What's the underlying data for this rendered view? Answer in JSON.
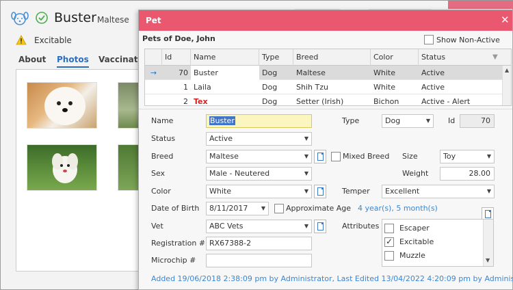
{
  "background": {
    "pet_name": "Buster",
    "pet_breed": "Maltese",
    "alert": "Excitable",
    "tabs": [
      {
        "label": "About",
        "active": false
      },
      {
        "label": "Photos",
        "active": true
      },
      {
        "label": "Vaccination",
        "active": false
      }
    ]
  },
  "dialog": {
    "title": "Pet",
    "close_glyph": "✕",
    "owner": "Pets of Doe, John",
    "show_non_active": {
      "label": "Show Non-Active",
      "checked": false
    },
    "grid": {
      "headers": [
        "Id",
        "Name",
        "Type",
        "Breed",
        "Color",
        "Status"
      ],
      "indicator": "→",
      "rows": [
        {
          "id": "70",
          "name": "Buster",
          "type": "Dog",
          "breed": "Maltese",
          "color": "White",
          "status": "Active",
          "selected": true
        },
        {
          "id": "1",
          "name": "Laila",
          "type": "Dog",
          "breed": "Shih Tzu",
          "color": "White",
          "status": "Active",
          "selected": false
        },
        {
          "id": "2",
          "name": "Tex",
          "type": "Dog",
          "breed": "Setter (Irish)",
          "color": "Bichon",
          "status": "Active - Alert",
          "selected": false
        }
      ]
    },
    "form": {
      "name_label": "Name",
      "name_value": "Buster",
      "type_label": "Type",
      "type_value": "Dog",
      "id_label": "Id",
      "id_value": "70",
      "status_label": "Status",
      "status_value": "Active",
      "breed_label": "Breed",
      "breed_value": "Maltese",
      "mixed_breed": {
        "label": "Mixed Breed",
        "checked": false
      },
      "size_label": "Size",
      "size_value": "Toy",
      "sex_label": "Sex",
      "sex_value": "Male - Neutered",
      "weight_label": "Weight",
      "weight_value": "28.00",
      "color_label": "Color",
      "color_value": "White",
      "temper_label": "Temper",
      "temper_value": "Excellent",
      "dob_label": "Date of Birth",
      "dob_value": "8/11/2017",
      "approx_age": {
        "label": "Approximate Age",
        "checked": false
      },
      "age_text": "4 year(s), 5 month(s)",
      "vet_label": "Vet",
      "vet_value": "ABC Vets",
      "attributes_label": "Attributes",
      "attributes": [
        {
          "label": "Escaper",
          "checked": false
        },
        {
          "label": "Excitable",
          "checked": true
        },
        {
          "label": "Muzzle",
          "checked": false
        }
      ],
      "registration_label": "Registration #",
      "registration_value": "RX67388-2",
      "microchip_label": "Microchip #",
      "microchip_value": ""
    },
    "footer": "Added 19/06/2018 2:38:09 pm by Administrator,  Last Edited 13/04/2022 4:20:09 pm by Administrator"
  },
  "colors": {
    "titlebar": "#e9586f",
    "link": "#3a86d4",
    "selected_row": "#dbdbdb",
    "focus_field": "#fbf6c0",
    "alert_red": "#d32020"
  }
}
